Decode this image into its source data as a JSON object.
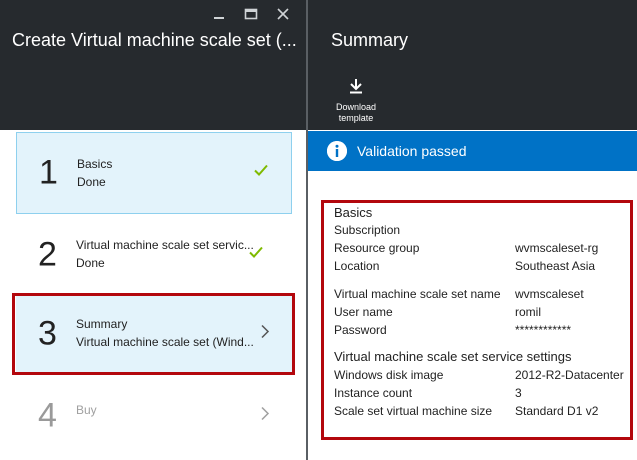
{
  "left_blade": {
    "title": "Create Virtual machine scale set (...",
    "steps": [
      {
        "number": "1",
        "title": "Basics",
        "subtitle": "Done"
      },
      {
        "number": "2",
        "title": "Virtual machine scale set servic...",
        "subtitle": "Done"
      },
      {
        "number": "3",
        "title": "Summary",
        "subtitle": "Virtual machine scale set (Wind..."
      },
      {
        "number": "4",
        "title": "Buy",
        "subtitle": ""
      }
    ]
  },
  "right_blade": {
    "title": "Summary",
    "download_label": "Download template",
    "validation": "Validation passed",
    "basics": {
      "heading": "Basics",
      "rows": [
        {
          "label": "Subscription",
          "value": ""
        },
        {
          "label": "Resource group",
          "value": "wvmscaleset-rg"
        },
        {
          "label": "Location",
          "value": "Southeast Asia"
        },
        {
          "label": "Virtual machine scale set name",
          "value": "wvmscaleset"
        },
        {
          "label": "User name",
          "value": "romil"
        },
        {
          "label": "Password",
          "value": "************"
        }
      ]
    },
    "service_settings": {
      "heading": "Virtual machine scale set service settings",
      "rows": [
        {
          "label": "Windows disk image",
          "value": "2012-R2-Datacenter"
        },
        {
          "label": "Instance count",
          "value": "3"
        },
        {
          "label": "Scale set virtual machine size",
          "value": "Standard D1 v2"
        }
      ]
    }
  },
  "colors": {
    "header_bg": "#262a2e",
    "accent_blue": "#0072c6",
    "highlight_red": "#b3070d",
    "check_green": "#7fba00",
    "selected_bg": "#e3f3fb"
  },
  "icons": [
    "minimize-icon",
    "maximize-icon",
    "close-icon",
    "download-icon",
    "info-icon",
    "checkmark-icon",
    "chevron-right-icon"
  ]
}
